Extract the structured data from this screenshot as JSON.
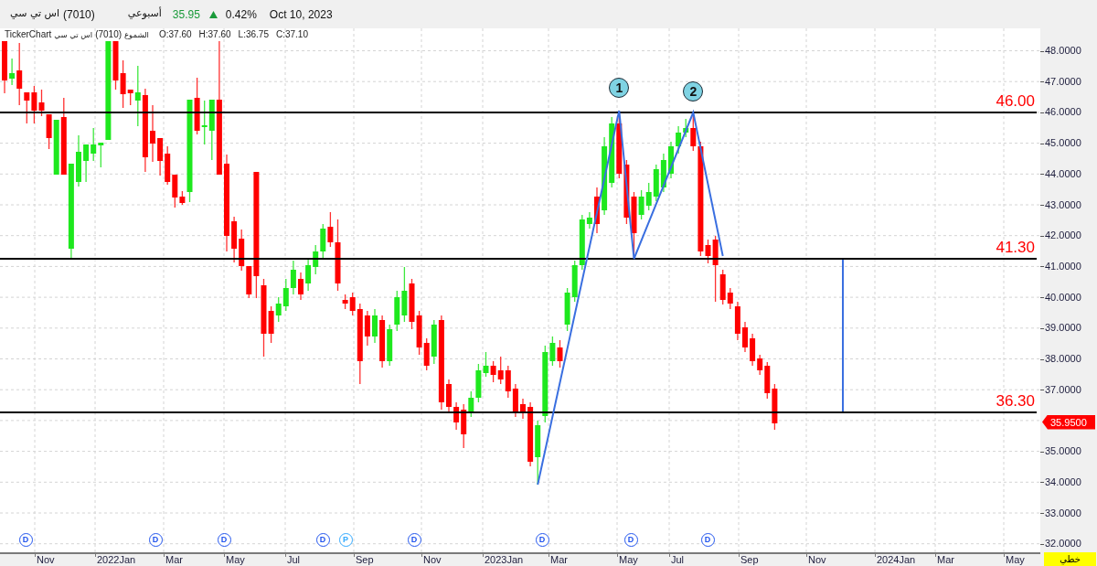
{
  "header": {
    "symbol_name": "اس تي سي",
    "symbol_code": "(7010)",
    "period": "أسبوعي",
    "price": "35.95",
    "price_up": true,
    "change": "0.42%",
    "date": "Oct 10, 2023"
  },
  "legend": {
    "source": "TickerChart",
    "symbol_name": "اس تي سي",
    "symbol_code": "(7010)",
    "chart_type": "الشموع",
    "ohlc": [
      "O:37.60",
      "H:37.60",
      "L:36.75",
      "C:37.10"
    ]
  },
  "chart": {
    "peaks": [
      {
        "label": "1"
      },
      {
        "label": "2"
      }
    ],
    "levels": [
      {
        "label": "46.00"
      },
      {
        "label": "41.30"
      },
      {
        "label": "36.30"
      }
    ],
    "events": [
      {
        "label": "D",
        "color": "#2255ee"
      },
      {
        "label": "D",
        "color": "#2255ee"
      },
      {
        "label": "D",
        "color": "#2255ee"
      },
      {
        "label": "D",
        "color": "#2255ee"
      },
      {
        "label": "P",
        "color": "#33aaff"
      },
      {
        "label": "D",
        "color": "#2255ee"
      },
      {
        "label": "D",
        "color": "#2255ee"
      },
      {
        "label": "D",
        "color": "#2255ee"
      },
      {
        "label": "D",
        "color": "#2255ee"
      }
    ],
    "price_axis": {
      "labels": [
        "48.0000",
        "47.0000",
        "46.0000",
        "45.0000",
        "44.0000",
        "43.0000",
        "42.0000",
        "41.0000",
        "40.0000",
        "39.0000",
        "38.0000",
        "37.0000",
        "35.0000",
        "34.0000",
        "33.0000",
        "32.0000"
      ],
      "last_price": "35.9500"
    },
    "time_axis": {
      "labels": [
        "Nov",
        "2022Jan",
        "Mar",
        "May",
        "Jul",
        "Sep",
        "Nov",
        "2023Jan",
        "Mar",
        "May",
        "Jul",
        "Sep",
        "Nov",
        "2024Jan",
        "Mar",
        "May"
      ]
    },
    "scale_mode": "خطي"
  }
}
